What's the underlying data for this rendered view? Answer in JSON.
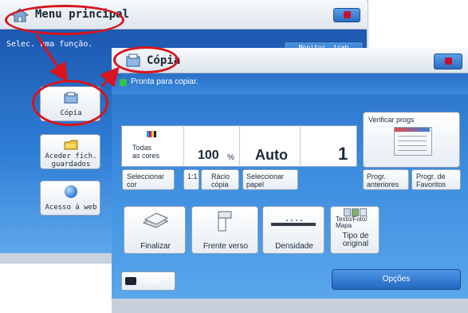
{
  "back_screen": {
    "title": "Menu principal",
    "subtitle": "Selec. uma função.",
    "top_right_label": "Monitor. trab",
    "buttons": [
      {
        "label": "Cópia"
      },
      {
        "label_line1": "Aceder fich.",
        "label_line2": "guardados"
      },
      {
        "label": "Acesso à web"
      }
    ]
  },
  "front_screen": {
    "title": "Cópia",
    "status": "Pronta para copiar.",
    "summary": {
      "color_line1": "Todas",
      "color_line2": "as cores",
      "ratio_value": "100",
      "ratio_unit": "%",
      "paper_value": "Auto",
      "copies": "1"
    },
    "buttons": {
      "select_color_1": "Seleccionar",
      "select_color_2": "cor",
      "ratio_1to1": "1:1",
      "ratio_copy_1": "Rácio",
      "ratio_copy_2": "cópia",
      "select_paper_1": "Seleccionar",
      "select_paper_2": "papel",
      "check_jobs": "Verificar progs",
      "prev_progs_1": "Progr.",
      "prev_progs_2": "anteriores",
      "favorites_1": "Progr. de",
      "favorites_2": "Favoritos"
    },
    "functions": [
      {
        "label": "Finalizar"
      },
      {
        "label": "Frente verso"
      },
      {
        "label": "Densidade"
      },
      {
        "label_top_1": "Texto/Foto/",
        "label_top_2": "Mapa",
        "label_1": "Tipo de",
        "label_2": "original"
      }
    ],
    "interrupt": "Interr.",
    "options": "Opções"
  },
  "colors": {
    "annotation_red": "#d9141c",
    "blue_gradient": "#3d8ee0"
  }
}
